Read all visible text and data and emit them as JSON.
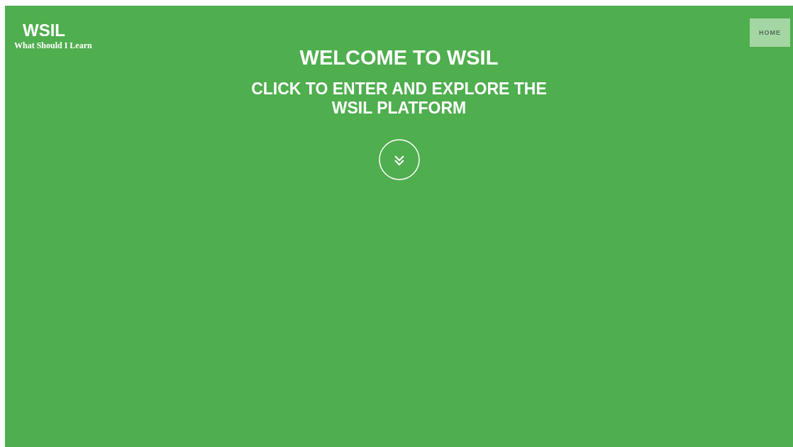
{
  "logo": {
    "title": "WSIL",
    "subtitle": "What Should I Learn"
  },
  "nav": [
    {
      "label": "HOME"
    }
  ],
  "hero": {
    "title": "WELCOME TO WSIL",
    "subtitle": "CLICK TO ENTER AND EXPLORE THE WSIL PLATFORM"
  }
}
